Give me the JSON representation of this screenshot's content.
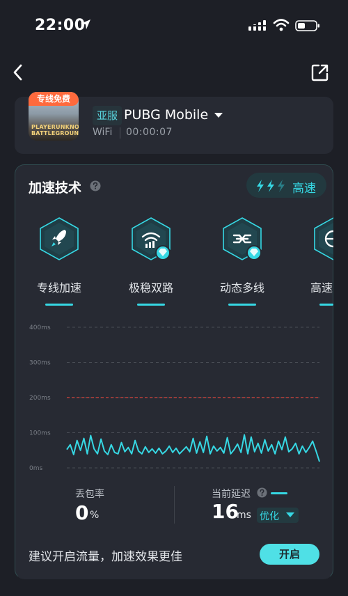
{
  "status_bar": {
    "time": "22:00"
  },
  "game": {
    "badge": "专线免费",
    "icon_logo_text": "PLAYERUNKNOWN'S BATTLEGROUNDS",
    "region": "亚服",
    "name": "PUBG Mobile",
    "network": "WiFi",
    "timer": "00:00:07"
  },
  "panel": {
    "title": "加速技术",
    "speed_label": "高速",
    "techs": [
      {
        "label": "专线加速",
        "icon": "rocket-icon"
      },
      {
        "label": "极稳双路",
        "icon": "dual-wifi-icon"
      },
      {
        "label": "动态多线",
        "icon": "multi-line-icon"
      },
      {
        "label": "高速",
        "icon": "globe-icon"
      }
    ]
  },
  "chart_data": {
    "type": "line",
    "y_ticks": [
      "400ms",
      "300ms",
      "200ms",
      "100ms",
      "0ms"
    ],
    "ylim": [
      0,
      400
    ],
    "threshold": 200,
    "series": [
      {
        "color": "#36d8e4",
        "values": [
          52,
          66,
          38,
          78,
          50,
          84,
          40,
          92,
          54,
          40,
          82,
          48,
          38,
          66,
          44,
          40,
          72,
          46,
          58,
          40,
          78,
          48,
          40,
          60,
          44,
          54,
          42,
          56,
          40,
          48,
          62,
          44,
          56,
          40,
          50,
          60,
          46,
          84,
          42,
          74,
          44,
          90,
          40,
          62,
          48,
          58,
          42,
          86,
          40,
          52,
          68,
          44,
          94,
          40,
          88,
          46,
          70,
          42,
          80,
          48,
          66,
          40,
          76,
          52,
          88,
          46,
          54,
          70,
          40,
          62,
          44,
          58,
          76,
          48,
          18
        ]
      }
    ]
  },
  "stats": {
    "loss_label": "丢包率",
    "loss_value": "0",
    "loss_unit": "%",
    "latency_label": "当前延迟",
    "latency_value": "16",
    "latency_unit": "ms",
    "optimize_label": "优化"
  },
  "footer": {
    "tip": "建议开启流量，加速效果更佳",
    "open_button": "开启"
  }
}
